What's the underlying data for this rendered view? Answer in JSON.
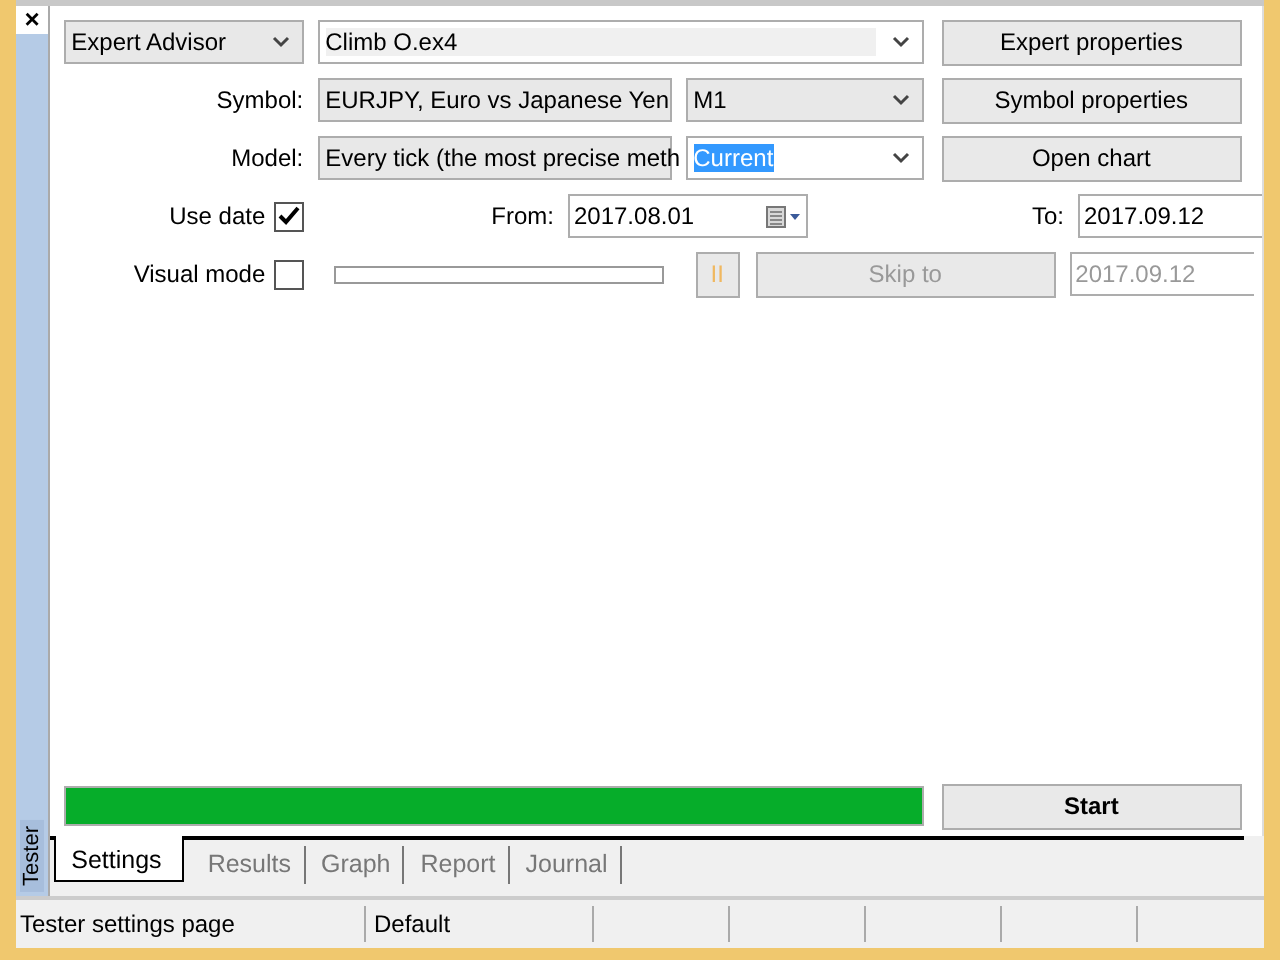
{
  "sidebar": {
    "close": "×",
    "title": "Tester"
  },
  "form": {
    "program_type": "Expert Advisor",
    "program_file": "Climb O.ex4",
    "symbol": {
      "label": "Symbol:",
      "value": "EURJPY, Euro vs Japanese Yen"
    },
    "period": "M1",
    "model": {
      "label": "Model:",
      "value": "Every tick (the most precise meth"
    },
    "spread": {
      "value": "Current",
      "text_selected": true
    },
    "use_date": {
      "label": "Use date",
      "checked": true
    },
    "from": {
      "label": "From:",
      "value": "2017.08.01"
    },
    "to": {
      "label": "To:",
      "value": "2017.09.12"
    },
    "visual_mode": {
      "label": "Visual mode",
      "checked": false
    },
    "pause": {
      "label": "II",
      "disabled": true
    },
    "skip_to": {
      "label": "Skip to",
      "disabled": true
    },
    "skip_date": {
      "value": "2017.09.12",
      "disabled": true
    },
    "buttons": [
      "Expert properties",
      "Symbol properties",
      "Open chart"
    ]
  },
  "progress": {
    "level": 1.0
  },
  "start": "Start",
  "tabs": [
    {
      "label": "Settings",
      "selected": true
    },
    {
      "label": "Results",
      "selected": false
    },
    {
      "label": "Graph",
      "selected": false
    },
    {
      "label": "Report",
      "selected": false
    },
    {
      "label": "Journal",
      "selected": false
    }
  ],
  "status_bar": [
    "Tester settings page",
    "Default"
  ]
}
